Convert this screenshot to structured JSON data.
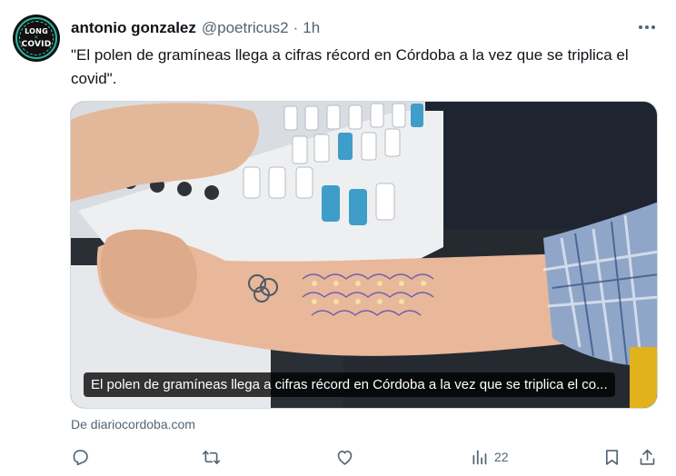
{
  "author": {
    "name": "antonio gonzalez",
    "handle": "@poetricus2",
    "separator": "·",
    "time": "1h",
    "avatar_text": [
      "LONG",
      "COVID"
    ]
  },
  "tweet": {
    "text": "\"El polen de gramíneas llega a cifras récord en Córdoba a la vez que se triplica el covid\"."
  },
  "card": {
    "caption": "El polen de gramíneas llega a cifras récord en Córdoba a la vez que se triplica el co...",
    "source": "De diariocordoba.com",
    "image_description_icon": "photo-allergy-skin-test"
  },
  "actions": {
    "reply_icon": "reply-icon",
    "retweet_icon": "retweet-icon",
    "like_icon": "heart-icon",
    "views_icon": "views-icon",
    "views_count": "22",
    "bookmark_icon": "bookmark-icon",
    "share_icon": "share-icon"
  },
  "colors": {
    "text_primary": "#0f1419",
    "text_secondary": "#536471",
    "border": "#cfd9de"
  }
}
